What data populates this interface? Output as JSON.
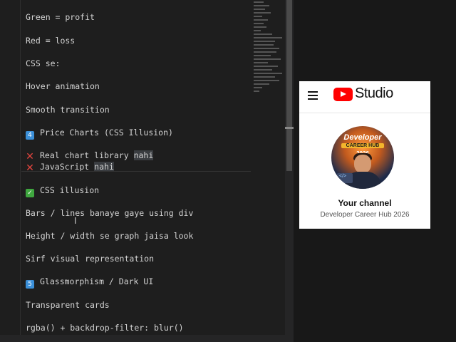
{
  "editor": {
    "lines": [
      {
        "text": "Green = profit"
      },
      {
        "text": "Red = loss"
      },
      {
        "text": "CSS se:"
      },
      {
        "text": "Hover animation"
      },
      {
        "text": "Smooth transition"
      },
      {
        "icon": "4",
        "text": "Price Charts (CSS Illusion)"
      },
      {
        "icon": "✕",
        "text": "Real chart library ",
        "hl": "nahi"
      },
      {
        "icon": "✕",
        "text": "JavaScript ",
        "hl": "nahi"
      },
      {
        "icon": "✓",
        "text": "CSS illusion"
      },
      {
        "text": "Bars / lines banaye gaye using div"
      },
      {
        "text": "Height / width se graph jaisa look"
      },
      {
        "text": "Sirf visual representation"
      },
      {
        "icon": "5",
        "text": "Glassmorphism / Dark UI"
      },
      {
        "text": "Transparent cards"
      },
      {
        "text": "rgba() + backdrop-filter: blur()"
      }
    ]
  },
  "studio": {
    "brand": "Studio",
    "avatar_line1": "Developer",
    "avatar_line2": "CAREER HUB",
    "avatar_line3": "2026",
    "avatar_code": "</>",
    "channel_title": "Your channel",
    "channel_name": "Developer Career Hub 2026"
  },
  "colors": {
    "editor_bg": "#1e1e1e",
    "youtube_red": "#ff0000",
    "keycap_blue": "#3b8fd8",
    "cross_red": "#e0443e",
    "check_green": "#3fa73f"
  }
}
